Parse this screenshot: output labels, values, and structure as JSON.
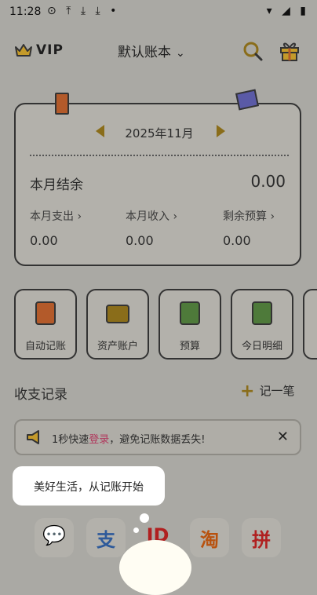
{
  "status_bar": {
    "time": "11:28",
    "left_icons": "⊙ ⤒ ⤓ ⤓ •",
    "right_icons": "▾ ◢ ▮"
  },
  "header": {
    "vip_label": "VIP",
    "book_name": "默认账本"
  },
  "card": {
    "month": "2025年11月",
    "balance_label": "本月结余",
    "balance_value": "0.00",
    "stats": [
      {
        "label": "本月支出",
        "value": "0.00"
      },
      {
        "label": "本月收入",
        "value": "0.00"
      },
      {
        "label": "剩余预算",
        "value": "0.00"
      }
    ]
  },
  "quick_actions": [
    {
      "label": "自动记账",
      "icon": "auto-record-icon",
      "color": "#b35a2a"
    },
    {
      "label": "资产账户",
      "icon": "wallet-icon",
      "color": "#8a6d1a"
    },
    {
      "label": "预算",
      "icon": "calculator-icon",
      "color": "#4e7a3a"
    },
    {
      "label": "今日明细",
      "icon": "receipt-icon",
      "color": "#4e7a3a"
    }
  ],
  "records": {
    "title": "收支记录",
    "add_label": "记一笔"
  },
  "notice": {
    "prefix": "1秒快速",
    "login": "登录",
    "suffix": "，避免记账数据丢失!"
  },
  "bubble": {
    "text": "美好生活，从记账开始"
  },
  "apps": [
    {
      "glyph": "💬",
      "name": "wechat",
      "color": "#3f8a2e"
    },
    {
      "glyph": "支",
      "name": "alipay",
      "color": "#2e5a9a"
    },
    {
      "glyph": "JD",
      "name": "jd",
      "color": "#b02020"
    },
    {
      "glyph": "淘",
      "name": "taobao",
      "color": "#b8520f"
    },
    {
      "glyph": "拼",
      "name": "pinduoduo",
      "color": "#b02020"
    }
  ]
}
